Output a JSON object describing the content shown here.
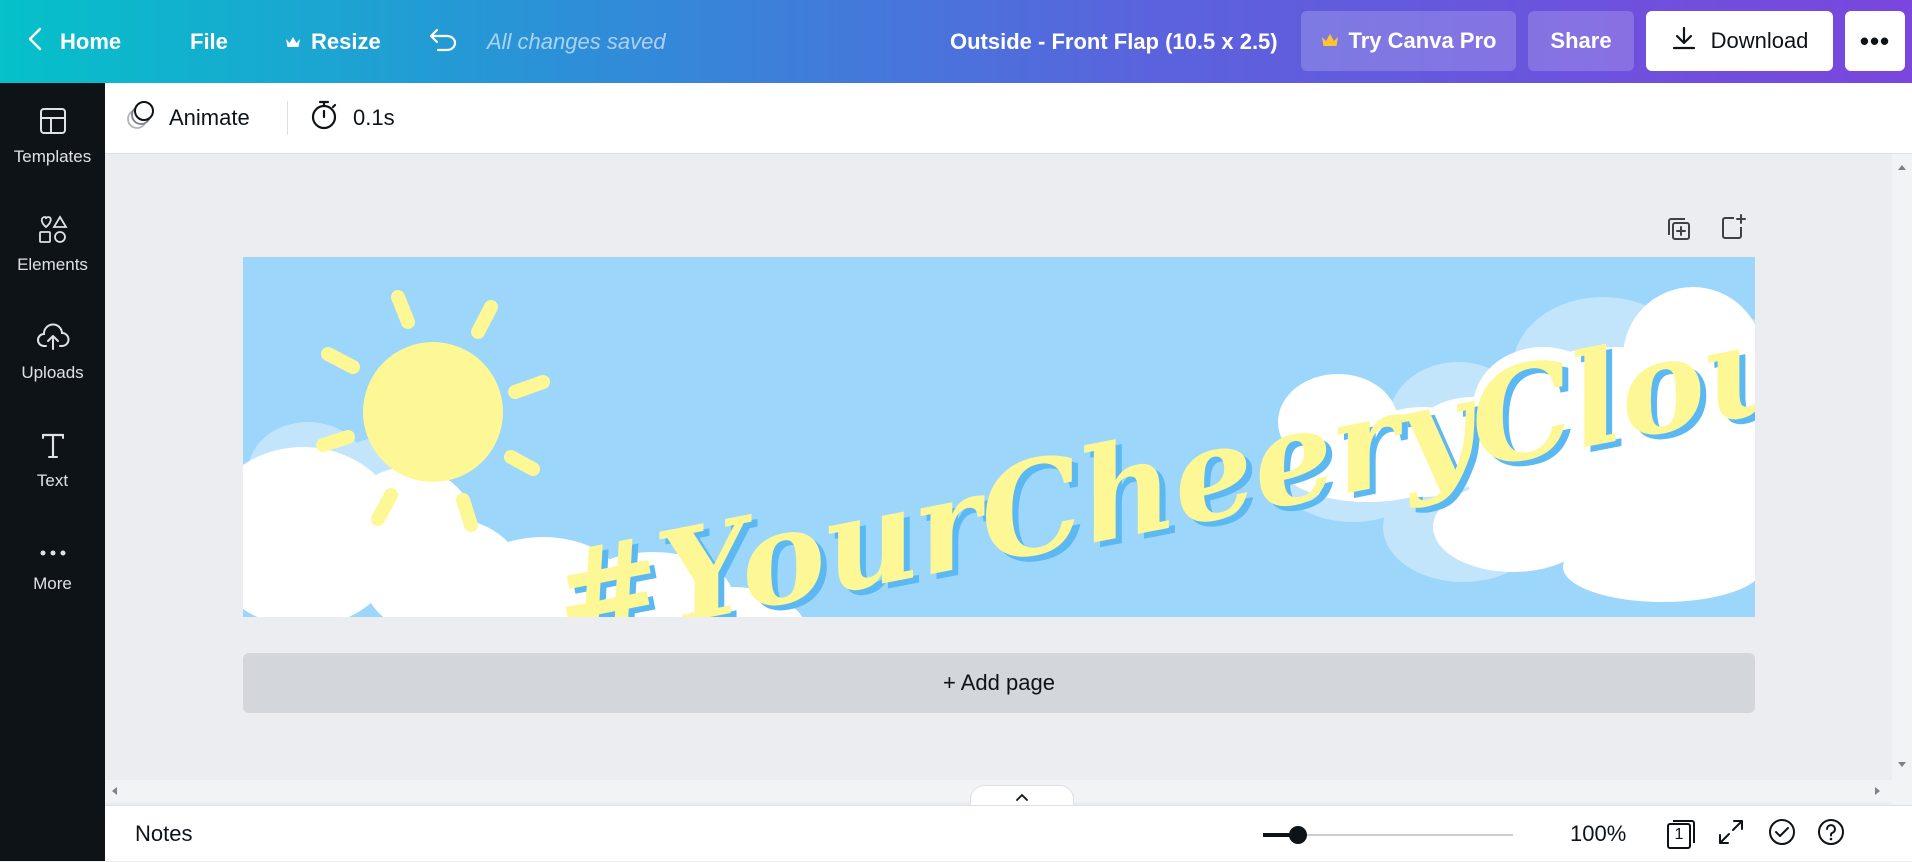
{
  "topbar": {
    "home_label": "Home",
    "file_label": "File",
    "resize_label": "Resize",
    "saved_status": "All changes saved",
    "document_title": "Outside - Front Flap (10.5 x 2.5)",
    "try_pro_label": "Try Canva Pro",
    "share_label": "Share",
    "download_label": "Download",
    "more_label": "•••"
  },
  "sidebar": {
    "items": [
      {
        "label": "Templates",
        "icon": "templates-icon"
      },
      {
        "label": "Elements",
        "icon": "elements-icon"
      },
      {
        "label": "Uploads",
        "icon": "uploads-icon"
      },
      {
        "label": "Text",
        "icon": "text-icon"
      },
      {
        "label": "More",
        "icon": "more-icon"
      }
    ]
  },
  "toolbar": {
    "animate_label": "Animate",
    "duration": "0.1s"
  },
  "design": {
    "headline": "#YourCheeryCloud",
    "background_color": "#9dd6fb",
    "text_color": "#fdf895",
    "shadow_color": "#5cb8f2"
  },
  "canvas": {
    "add_page_label": "+ Add page"
  },
  "bottombar": {
    "notes_label": "Notes",
    "zoom_percent": "100%",
    "zoom_slider_fraction": 0.14,
    "page_count": "1"
  },
  "colors": {
    "sidebar_bg": "#0e1318",
    "canvas_bg": "#ebedf0",
    "sun": "#fdf895"
  }
}
